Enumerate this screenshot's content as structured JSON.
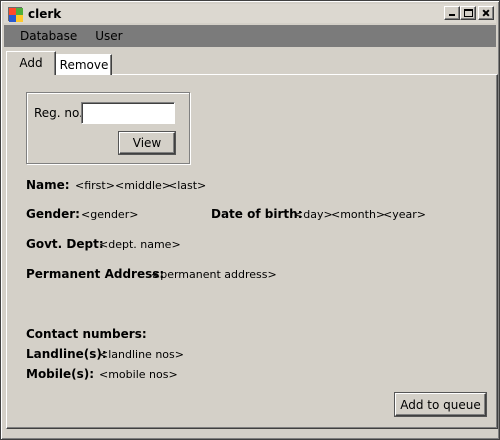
{
  "window": {
    "title": "clerk"
  },
  "menu": {
    "items": [
      "Database",
      "User"
    ]
  },
  "tabs": [
    {
      "label": "Add"
    },
    {
      "label": "Remove"
    }
  ],
  "search": {
    "label": "Reg. no.",
    "value": "",
    "button_label": "View"
  },
  "fields": {
    "name_label": "Name:",
    "first": "<first>",
    "middle": "<middle>",
    "last": "<last>",
    "gender_label": "Gender:",
    "gender": "<gender>",
    "dob_label": "Date of birth:",
    "day": "<day>",
    "month": "<month>",
    "year": "<year>",
    "dept_label": "Govt. Dept:",
    "dept": "<dept. name>",
    "address_label": "Permanent Address:",
    "address": "<permanent address>",
    "contact_heading": "Contact numbers:",
    "landline_label": "Landline(s):",
    "landline": "<landline nos>",
    "mobile_label": "Mobile(s):",
    "mobile": "<mobile nos>"
  },
  "actions": {
    "add_to_queue_label": "Add to queue"
  },
  "icons": {
    "app": "app-icon",
    "minimize": "minimize-icon",
    "maximize": "maximize-icon",
    "close": "close-icon"
  }
}
